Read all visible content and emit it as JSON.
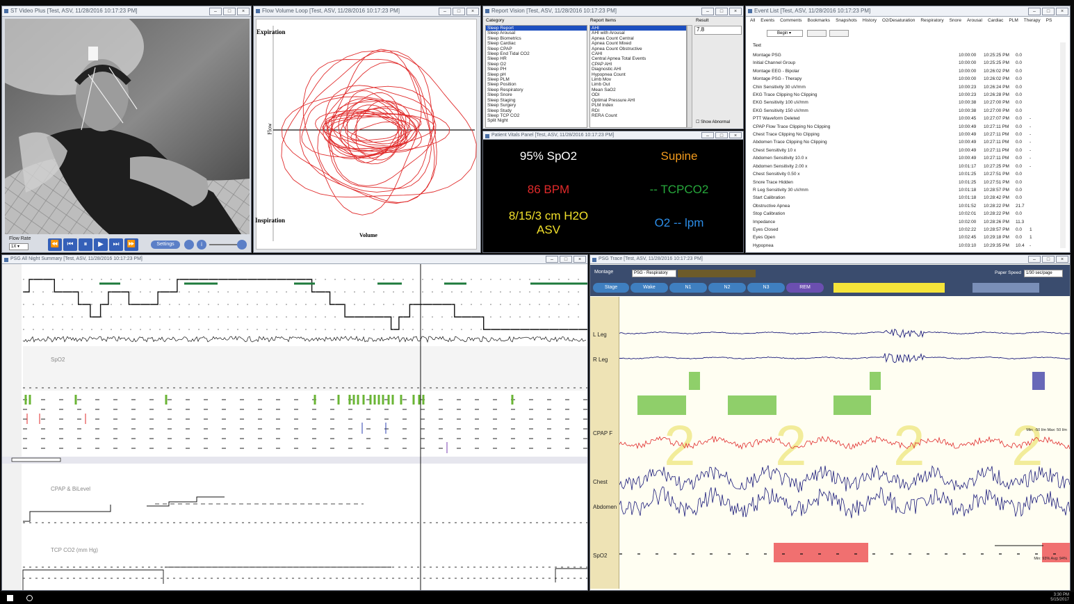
{
  "windows": {
    "video": {
      "title": "ST Video Plus [Test, ASV, 11/28/2016 10:17:23 PM]",
      "flow_rate_label": "Flow Rate",
      "flow_rate_value": "1X",
      "settings_label": "Settings"
    },
    "flowloop": {
      "title": "Flow Volume Loop [Test, ASV, 11/28/2016 10:17:23 PM]",
      "expiration": "Expiration",
      "inspiration": "Inspiration",
      "flow": "Flow",
      "volume": "Volume"
    },
    "report": {
      "title": "Report Vision [Test, ASV, 11/28/2016 10:17:23 PM]",
      "category_header": "Category",
      "report_items_header": "Report Items",
      "result_header": "Result",
      "result_value": "7.8",
      "show_abnormal": "Show Abnormal",
      "categories": [
        "Sleep Report",
        "Sleep Arousal",
        "Sleep Biometrics",
        "Sleep Cardiac",
        "Sleep CPAP",
        "Sleep End Tidal CO2",
        "Sleep HR",
        "Sleep O2",
        "Sleep PH",
        "Sleep pH",
        "Sleep PLM",
        "Sleep Position",
        "Sleep Respiratory",
        "Sleep Snore",
        "Sleep Staging",
        "Sleep Surgery",
        "Sleep Study",
        "Sleep TCP CO2",
        "Split Night"
      ],
      "report_items": [
        "AHI",
        "AHI with Arousal",
        "Apnea Count Central",
        "Apnea Count Mixed",
        "Apnea Count Obstructive",
        "CAHI",
        "Central Apnea Total Events",
        "CPAP AHI",
        "Diagnostic AHI",
        "Hypopnea Count",
        "Limb Mov",
        "Limb Out",
        "Mean SaO2",
        "ODI",
        "Optimal Pressure AHI",
        "PLM Index",
        "RDI",
        "RERA Count"
      ]
    },
    "vitals": {
      "title": "Patient Vitals Panel [Test, ASV, 11/28/2016 10:17:23 PM]",
      "spo2": "95% SpO2",
      "position": "Supine",
      "bpm": "86 BPM",
      "tcpco2": "-- TCPCO2",
      "pressure_line1": "8/15/3 cm H2O",
      "pressure_line2": "ASV",
      "o2": "O2 -- lpm"
    },
    "events": {
      "title": "Event List [Test, ASV, 11/28/2016 10:17:23 PM]",
      "tabs": [
        "All",
        "Events",
        "Comments",
        "Bookmarks",
        "Snapshots",
        "History",
        "O2/Desaturation",
        "Respiratory",
        "Snore",
        "Arousal",
        "Cardiac",
        "PLM",
        "Therapy",
        "PS"
      ],
      "filter_label": "Begin",
      "column_header": "Text",
      "rows": [
        [
          "Montage PSG",
          "10:00:00",
          "10:25:25 PM",
          "0.0",
          ""
        ],
        [
          "Initial Channel Group",
          "10:00:00",
          "10:25:25 PM",
          "0.0",
          ""
        ],
        [
          "Montage EEG - Bipolar",
          "10:00:00",
          "10:26:02 PM",
          "0.0",
          ""
        ],
        [
          "Montage PSG - Therapy",
          "10:00:00",
          "10:26:02 PM",
          "0.0",
          ""
        ],
        [
          "Chin Sensitivity 30 uV/mm",
          "10:00:23",
          "10:26:24 PM",
          "0.0",
          ""
        ],
        [
          "EKG Trace Clipping No Clipping",
          "10:00:23",
          "10:26:28 PM",
          "0.0",
          ""
        ],
        [
          "EKG Sensitivity 100 uV/mm",
          "10:00:38",
          "10:27:00 PM",
          "0.0",
          ""
        ],
        [
          "EKG Sensitivity 150 uV/mm",
          "10:00:38",
          "10:27:00 PM",
          "0.0",
          ""
        ],
        [
          "PTT Waveform Deleted",
          "10:00:45",
          "10:27:07 PM",
          "0.0",
          "-"
        ],
        [
          "CPAP Flow Trace Clipping No Clipping",
          "10:00:49",
          "10:27:11 PM",
          "0.0",
          "-"
        ],
        [
          "Chest Trace Clipping No Clipping",
          "10:00:49",
          "10:27:11 PM",
          "0.0",
          "-"
        ],
        [
          "Abdomen Trace Clipping No Clipping",
          "10:00:49",
          "10:27:11 PM",
          "0.0",
          "-"
        ],
        [
          "Chest Sensitivity 10 x",
          "10:00:49",
          "10:27:11 PM",
          "0.0",
          "-"
        ],
        [
          "Abdomen Sensitivity 10.0 x",
          "10:00:49",
          "10:27:11 PM",
          "0.0",
          "-"
        ],
        [
          "Abdomen Sensitivity 2.00 x",
          "10:01:17",
          "10:27:25 PM",
          "0.0",
          "-"
        ],
        [
          "Chest Sensitivity 0.50 x",
          "10:01:25",
          "10:27:51 PM",
          "0.0",
          ""
        ],
        [
          "Snore Trace Hidden",
          "10:01:25",
          "10:27:51 PM",
          "0.0",
          ""
        ],
        [
          "R Leg Sensitivity 30 uV/mm",
          "10:01:18",
          "10:28:57 PM",
          "0.0",
          ""
        ],
        [
          "Start Calibration",
          "10:01:18",
          "10:28:42 PM",
          "0.0",
          ""
        ],
        [
          "Obstructive Apnea",
          "10:01:52",
          "10:28:22 PM",
          "21.7",
          ""
        ],
        [
          "Stop Calibration",
          "10:02:01",
          "10:28:22 PM",
          "0.0",
          ""
        ],
        [
          "Impedance",
          "10:02:00",
          "10:28:26 PM",
          "11.3",
          ""
        ],
        [
          "Eyes Closed",
          "10:02:22",
          "10:28:57 PM",
          "0.0",
          "1"
        ],
        [
          "Eyes Open",
          "10:02:45",
          "10:29:18 PM",
          "0.0",
          "1"
        ],
        [
          "Hypopnea",
          "10:03:10",
          "10:29:35 PM",
          "10.4",
          "-"
        ]
      ]
    },
    "summary": {
      "title": "PSG All Night Summary [Test, ASV, 11/28/2016 10:17:23 PM]",
      "spo2_label": "SpO2",
      "cpap_label": "CPAP & BiLevel",
      "tcp_label": "TCP CO2 (mm Hg)"
    },
    "psg": {
      "title": "PSG Trace [Test, ASV, 11/28/2016 10:17:23 PM]",
      "montage_label": "Montage",
      "montage_value": "PSG - Respiratory",
      "paper_speed_label": "Paper Speed",
      "paper_speed_value": "1/30 sec/page",
      "stage_buttons": [
        "Stage",
        "Wake",
        "N1",
        "N2",
        "N3",
        "REM"
      ],
      "channels": [
        "L Leg",
        "R Leg",
        "CPAP F",
        "Chest",
        "Abdomen",
        "SpO2"
      ],
      "stage_digit": "2",
      "cpap_minmax": "Min: -50 l/m  Max: 50 l/m",
      "spo2_minmax": "Min: 93%  Avg: 94%"
    }
  },
  "clock": {
    "time": "3:30 PM",
    "date": "5/15/2017"
  },
  "colors": {
    "accent": "#1d4fbf",
    "spo2_text": "#ffffff",
    "bpm_text": "#e02a2a",
    "position_text": "#f39b1d",
    "tcpco2_text": "#27a83c",
    "pressure_text": "#f2e02b",
    "o2_text": "#2c8de8",
    "trace_blue": "#1a1a7a",
    "trace_red": "#e02a2a",
    "stage_green": "#8fcf6a",
    "spo2_alarm": "#f07070"
  }
}
